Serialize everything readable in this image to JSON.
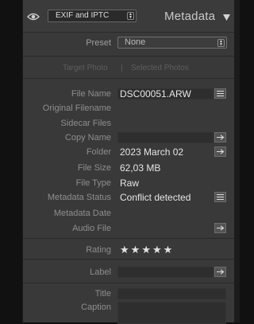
{
  "header": {
    "mode_select": "EXIF and IPTC",
    "title": "Metadata"
  },
  "preset": {
    "label": "Preset",
    "value": "None"
  },
  "target": {
    "target_photo": "Target Photo",
    "separator": "|",
    "selected_photos": "Selected Photos"
  },
  "fields": {
    "file_name": {
      "label": "File Name",
      "value": "DSC00051.ARW"
    },
    "original_filename": {
      "label": "Original Filename"
    },
    "sidecar_files": {
      "label": "Sidecar Files"
    },
    "copy_name": {
      "label": "Copy Name"
    },
    "folder": {
      "label": "Folder",
      "value": "2023 March 02"
    },
    "file_size": {
      "label": "File Size",
      "value": "62,03 MB"
    },
    "file_type": {
      "label": "File Type",
      "value": "Raw"
    },
    "metadata_status": {
      "label": "Metadata Status",
      "value": "Conflict detected"
    },
    "metadata_date": {
      "label": "Metadata Date"
    },
    "audio_file": {
      "label": "Audio File"
    },
    "rating": {
      "label": "Rating",
      "stars": 5,
      "star_glyph": "★"
    },
    "label": {
      "label": "Label"
    },
    "title": {
      "label": "Title"
    },
    "caption": {
      "label": "Caption"
    }
  },
  "icons": {
    "eye": "eye-icon",
    "collapse": "triangle-down-icon",
    "list": "list-icon",
    "arrow": "arrow-right-icon"
  },
  "colors": {
    "panel": "#393939",
    "text_label": "#8e8e8e",
    "text_value": "#e6e6e6"
  }
}
